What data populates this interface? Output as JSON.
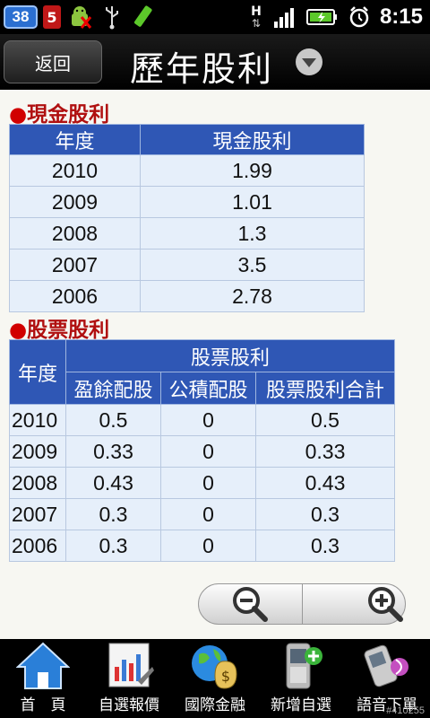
{
  "status_bar": {
    "badge_number": "38",
    "badge_s": "5",
    "network_label": "H",
    "time": "8:15"
  },
  "header": {
    "back_label": "返回",
    "title": "歷年股利"
  },
  "cash_dividend": {
    "section_title": "現金股利",
    "columns": [
      "年度",
      "現金股利"
    ],
    "rows": [
      {
        "year": "2010",
        "value": "1.99"
      },
      {
        "year": "2009",
        "value": "1.01"
      },
      {
        "year": "2008",
        "value": "1.3"
      },
      {
        "year": "2007",
        "value": "3.5"
      },
      {
        "year": "2006",
        "value": "2.78"
      }
    ]
  },
  "stock_dividend": {
    "section_title": "股票股利",
    "year_header": "年度",
    "group_header": "股票股利",
    "columns": [
      "盈餘配股",
      "公積配股",
      "股票股利合計"
    ],
    "rows": [
      {
        "year": "2010",
        "earnings": "0.5",
        "reserve": "0",
        "total": "0.5"
      },
      {
        "year": "2009",
        "earnings": "0.33",
        "reserve": "0",
        "total": "0.33"
      },
      {
        "year": "2008",
        "earnings": "0.43",
        "reserve": "0",
        "total": "0.43"
      },
      {
        "year": "2007",
        "earnings": "0.3",
        "reserve": "0",
        "total": "0.3"
      },
      {
        "year": "2006",
        "earnings": "0.3",
        "reserve": "0",
        "total": "0.3"
      }
    ]
  },
  "bottom_nav": {
    "items": [
      {
        "label": "首　頁",
        "icon": "home-icon"
      },
      {
        "label": "自選報價",
        "icon": "chart-icon"
      },
      {
        "label": "國際金融",
        "icon": "globe-money-icon"
      },
      {
        "label": "新增自選",
        "icon": "phone-add-icon"
      },
      {
        "label": "語音下單",
        "icon": "voice-phone-icon"
      }
    ]
  },
  "watermark": "#410255",
  "colors": {
    "table_header": "#2f57b5",
    "table_cell": "#e6effa",
    "section_title": "#b01010"
  }
}
